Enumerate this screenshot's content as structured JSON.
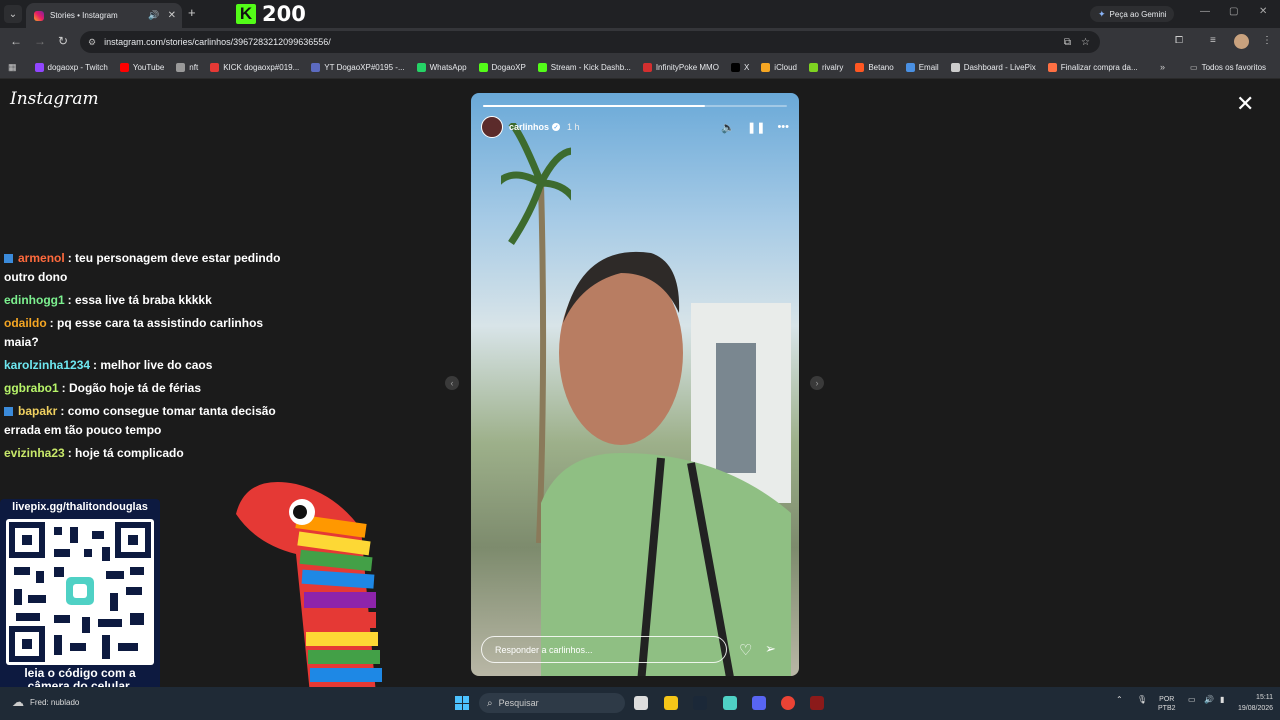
{
  "browser": {
    "tab_title": "Stories • Instagram",
    "url": "instagram.com/stories/carlinhos/3967283212099636556/",
    "gemini_label": "Peça ao Gemini",
    "bookmarks": [
      {
        "label": "dogaoxp - Twitch",
        "color": "#9146ff"
      },
      {
        "label": "YouTube",
        "color": "#ff0000"
      },
      {
        "label": "nft",
        "color": "#999999"
      },
      {
        "label": "KICK dogaoxp#019...",
        "color": "#e53935"
      },
      {
        "label": "YT DogaoXP#0195 -...",
        "color": "#5c6bc0"
      },
      {
        "label": "WhatsApp",
        "color": "#25d366"
      },
      {
        "label": "DogaoXP",
        "color": "#53fc18"
      },
      {
        "label": "Stream - Kick Dashb...",
        "color": "#53fc18"
      },
      {
        "label": "InfinityPoke MMO",
        "color": "#d32f2f"
      },
      {
        "label": "X",
        "color": "#000000"
      },
      {
        "label": "iCloud",
        "color": "#f5a623"
      },
      {
        "label": "rivalry",
        "color": "#7ed321"
      },
      {
        "label": "Betano",
        "color": "#ff5722"
      },
      {
        "label": "Email",
        "color": "#4a90e2"
      },
      {
        "label": "Dashboard - LivePix",
        "color": "#cccccc"
      },
      {
        "label": "Finalizar compra da...",
        "color": "#ff7043"
      }
    ],
    "all_bookmarks_label": "Todos os favoritos"
  },
  "overlay": {
    "kick_logo": "K",
    "kick_count": "200",
    "chat": [
      {
        "user": "armenol",
        "text": ": teu personagem deve estar pedindo outro dono",
        "badge": true
      },
      {
        "user": "edinhogg1",
        "text": ": essa live tá braba kkkkk",
        "badge": false
      },
      {
        "user": "odaildo",
        "text": ": pq esse cara ta assistindo carlinhos maia?",
        "badge": false
      },
      {
        "user": "karolzinha1234",
        "text": ": melhor live do caos",
        "badge": false
      },
      {
        "user": "ggbrabo1",
        "text": ": Dogão hoje tá de férias",
        "badge": false
      },
      {
        "user": "bapakr",
        "text": ": como consegue tomar tanta decisão errada em tão pouco tempo",
        "badge": true
      },
      {
        "user": "evizinha23",
        "text": ": hoje tá complicado",
        "badge": false
      }
    ],
    "qr_url": "livepix.gg/thalitondouglas",
    "qr_caption_1": "leia o código com a",
    "qr_caption_2": "câmera do celular."
  },
  "instagram": {
    "logo": "Instagram",
    "close_icon": "✕",
    "story_user": "carlinhos",
    "story_time": "1 h",
    "progress": 0.73,
    "reply_placeholder": "Responder a carlinhos..."
  },
  "taskbar": {
    "weather": "Fred: nublado",
    "search_placeholder": "Pesquisar",
    "lang_1": "POR",
    "lang_2": "PTB2",
    "time": "15:11",
    "date": "19/08/2026"
  }
}
